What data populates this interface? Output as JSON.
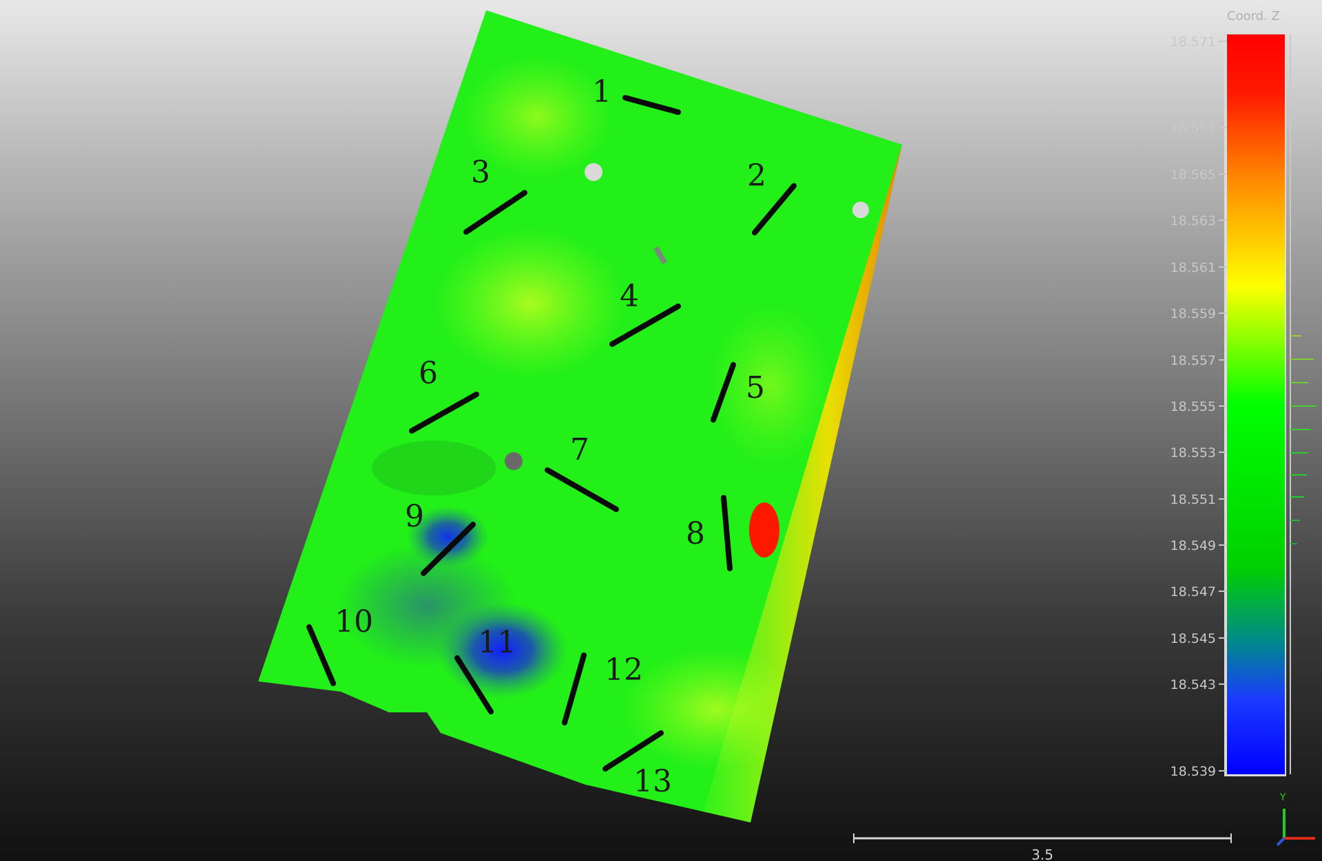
{
  "colors": {
    "scale_top": "#ff0000",
    "scale_orange": "#ff8c00",
    "scale_yellow": "#ffff00",
    "scale_green": "#00ff00",
    "scale_blue": "#0000ff",
    "section_line": "#0a0a0a"
  },
  "color_scale": {
    "title": "Coord. Z",
    "ticks": [
      "18.571",
      "18.567",
      "18.565",
      "18.563",
      "18.561",
      "18.559",
      "18.557",
      "18.555",
      "18.553",
      "18.551",
      "18.549",
      "18.547",
      "18.545",
      "18.543",
      "18.539"
    ]
  },
  "sections": [
    {
      "label": "1"
    },
    {
      "label": "2"
    },
    {
      "label": "3"
    },
    {
      "label": "4"
    },
    {
      "label": "5"
    },
    {
      "label": "6"
    },
    {
      "label": "7"
    },
    {
      "label": "8"
    },
    {
      "label": "9"
    },
    {
      "label": "10"
    },
    {
      "label": "11"
    },
    {
      "label": "12"
    },
    {
      "label": "13"
    }
  ],
  "scale_bar": {
    "label": "3.5"
  },
  "axis_gizmo": {
    "y_label": "Y"
  }
}
